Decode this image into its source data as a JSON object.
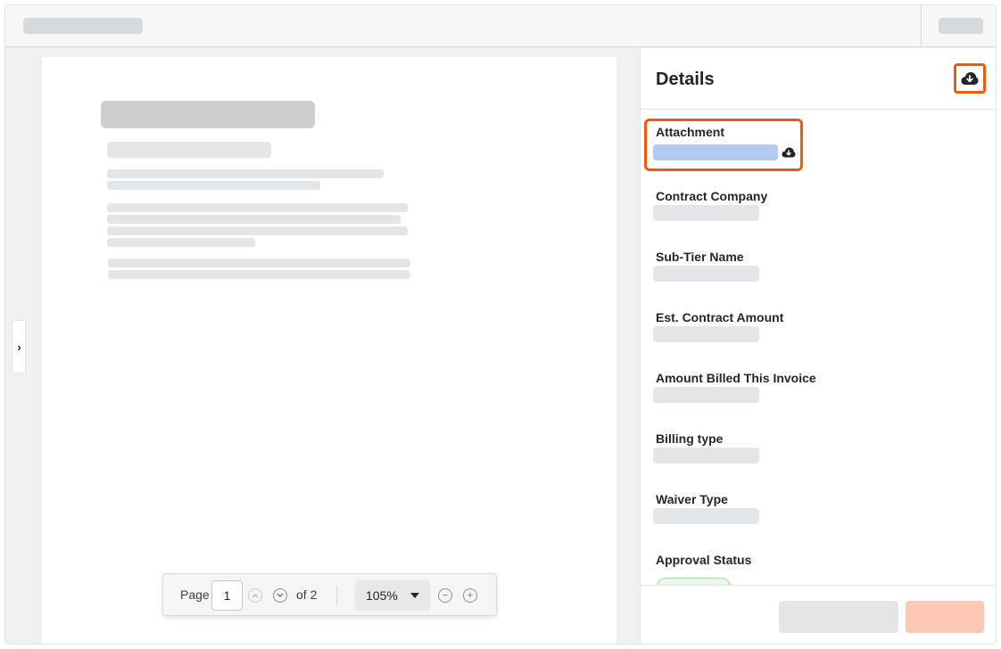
{
  "viewer": {
    "collapse_icon": "chevron-right-icon",
    "pager": {
      "page_label": "Page",
      "page_value": "1",
      "of_label": "of 2",
      "zoom_value": "105%",
      "zoom_out_glyph": "−",
      "zoom_in_glyph": "+"
    }
  },
  "details": {
    "title": "Details",
    "download_icon": "cloud-download-icon",
    "fields": [
      {
        "label": "Attachment"
      },
      {
        "label": "Contract Company"
      },
      {
        "label": "Sub-Tier Name"
      },
      {
        "label": "Est. Contract Amount"
      },
      {
        "label": "Amount Billed This Invoice"
      },
      {
        "label": "Billing type"
      },
      {
        "label": "Waiver Type"
      },
      {
        "label": "Approval Status"
      }
    ]
  },
  "colors": {
    "highlight": "#f05a0f",
    "attachment_link": "#b3cbf0",
    "primary_button": "#fcc9b4",
    "status_pill": "#e8f7ea"
  }
}
